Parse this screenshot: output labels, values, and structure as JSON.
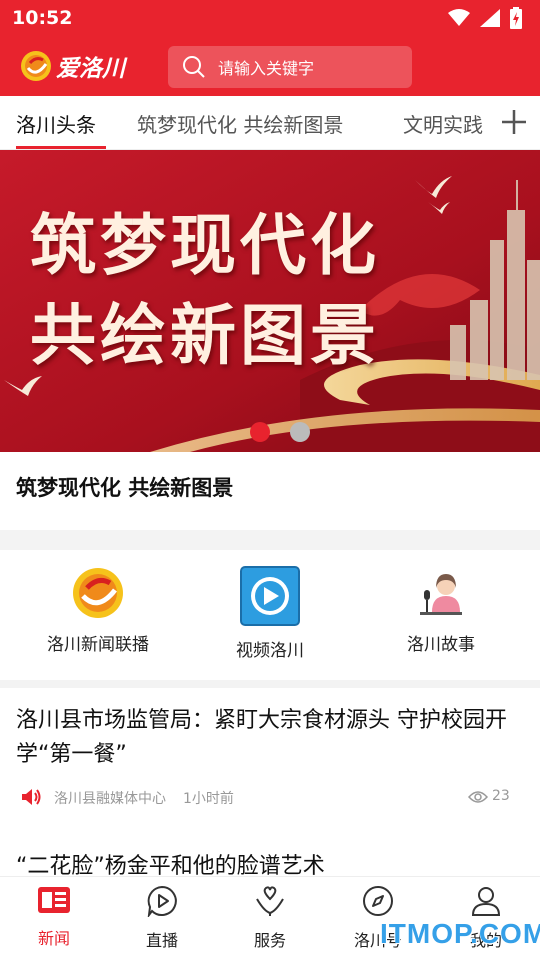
{
  "status_bar": {
    "time": "10:52"
  },
  "header": {
    "app_name": "爱洛川",
    "search_placeholder": "请输入关键字"
  },
  "tabs": [
    {
      "label": "洛川头条"
    },
    {
      "label": "筑梦现代化 共绘新图景"
    },
    {
      "label": "文明实践"
    }
  ],
  "banner": {
    "line1": "筑梦现代化",
    "line2": "共绘新图景",
    "slide_count": 2,
    "active_slide": 1,
    "caption": "筑梦现代化 共绘新图景"
  },
  "quick_links": [
    {
      "label": "洛川新闻联播",
      "icon": "news-broadcast-icon"
    },
    {
      "label": "视频洛川",
      "icon": "video-play-icon"
    },
    {
      "label": "洛川故事",
      "icon": "storyteller-icon"
    }
  ],
  "news": [
    {
      "title": "洛川县市场监管局：紧盯大宗食材源头 守护校园开学“第一餐”",
      "source": "洛川县融媒体中心",
      "time": "1小时前",
      "views": "23"
    },
    {
      "title": "“二花脸”杨金平和他的脸谱艺术"
    }
  ],
  "bottom_nav": [
    {
      "label": "新闻",
      "icon": "newspaper-icon",
      "active": true
    },
    {
      "label": "直播",
      "icon": "live-play-icon"
    },
    {
      "label": "服务",
      "icon": "service-icon"
    },
    {
      "label": "洛川号",
      "icon": "compass-icon"
    },
    {
      "label": "我的",
      "icon": "user-icon"
    }
  ],
  "colors": {
    "brand": "#e8232e",
    "watermark": "#35a0e8"
  },
  "watermark": "ITMOP.COM"
}
